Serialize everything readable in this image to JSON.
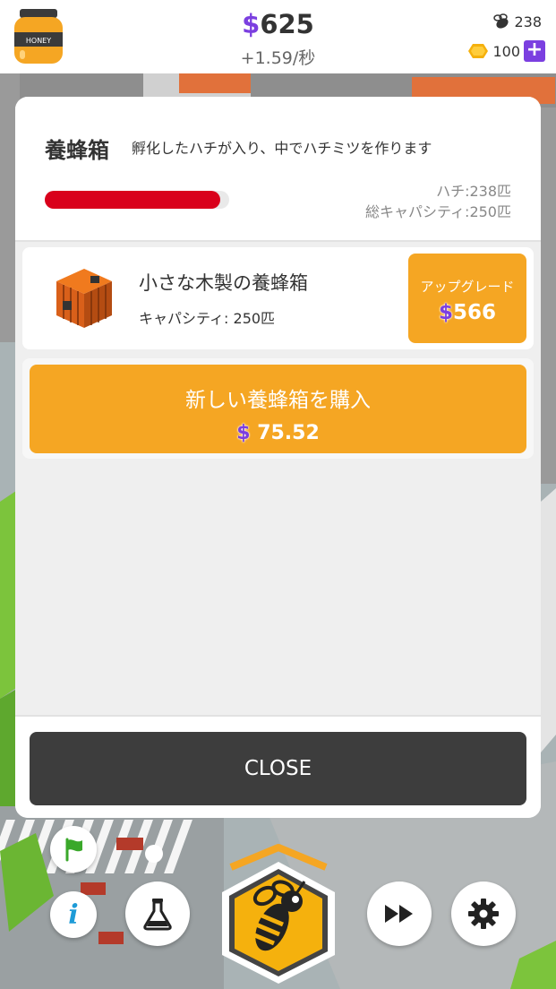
{
  "topbar": {
    "honey_jar_label": "HONEY",
    "money_symbol": "$",
    "money_value": "625",
    "income_rate": "+1.59/秒",
    "bee_total": "238",
    "gems": "100",
    "plus_label": "+"
  },
  "panel": {
    "title": "養蜂箱",
    "description": "孵化したハチが入り、中でハチミツを作ります",
    "capacity_fill": 0.952,
    "bees_label": "ハチ:238匹",
    "total_capacity_label": "総キャパシティ:250匹",
    "item": {
      "name": "小さな木製の養蜂箱",
      "capacity": "キャパシティ: 250匹",
      "upgrade_label": "アップグレード",
      "upgrade_cost": "566"
    },
    "buy": {
      "label": "新しい養蜂箱を購入",
      "cost": "75.52"
    },
    "close_label": "CLOSE"
  },
  "nav": {
    "info_glyph": "i"
  },
  "colors": {
    "accent_orange": "#f5a623",
    "currency_purple": "#7b3fe0",
    "progress_red": "#d9001b",
    "close_dark": "#3d3d3d"
  }
}
